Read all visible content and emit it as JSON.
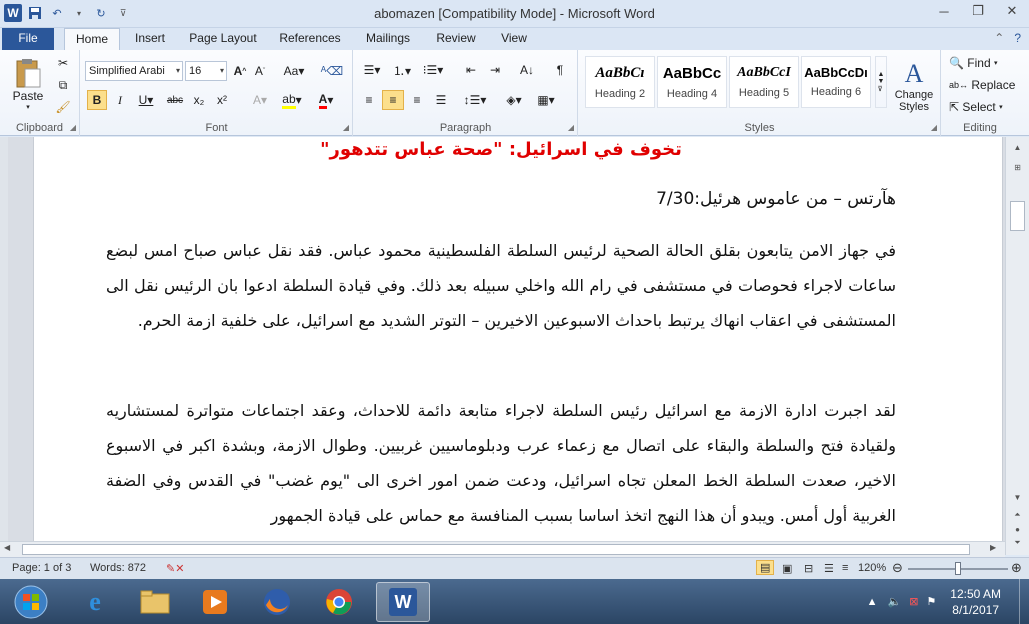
{
  "window": {
    "title": "abomazen [Compatibility Mode]  -  Microsoft Word"
  },
  "tabs": [
    {
      "label": "File"
    },
    {
      "label": "Home"
    },
    {
      "label": "Insert"
    },
    {
      "label": "Page Layout"
    },
    {
      "label": "References"
    },
    {
      "label": "Mailings"
    },
    {
      "label": "Review"
    },
    {
      "label": "View"
    }
  ],
  "ribbon": {
    "clipboard": {
      "paste_label": "Paste",
      "group_label": "Clipboard"
    },
    "font": {
      "font_name": "Simplified Arabi",
      "font_size": "16",
      "group_label": "Font"
    },
    "paragraph": {
      "group_label": "Paragraph"
    },
    "styles": {
      "group_label": "Styles",
      "items": [
        {
          "sample": "AaBbCı",
          "name": "Heading 2"
        },
        {
          "sample": "AaBbCc",
          "name": "Heading 4"
        },
        {
          "sample": "AaBbCcI",
          "name": "Heading 5"
        },
        {
          "sample": "AaBbCcDı",
          "name": "Heading 6"
        }
      ],
      "change_styles": "Change Styles"
    },
    "editing": {
      "find": "Find",
      "replace": "Replace",
      "select": "Select",
      "group_label": "Editing"
    }
  },
  "document": {
    "headline": "تخوف في اسرائيل: \"صحة عباس تتدهور\"",
    "byline": "هآرتس – من عاموس هرئيل:7/30",
    "paragraph1": "في جهاز الامن يتابعون بقلق الحالة الصحية لرئيس السلطة الفلسطينية محمود عباس. فقد نقل عباس صباح امس لبضع ساعات لاجراء فحوصات في مستشفى في رام الله واخلي سبيله بعد ذلك. وفي قيادة السلطة ادعوا بان الرئيس نقل الى المستشفى في اعقاب انهاك يرتبط باحداث الاسبوعين الاخيرين – التوتر الشديد مع اسرائيل، على خلفية ازمة الحرم.",
    "paragraph2": "لقد اجبرت ادارة الازمة مع اسرائيل رئيس السلطة لاجراء متابعة دائمة للاحداث، وعقد اجتماعات متواترة لمستشاريه ولقيادة فتح والسلطة والبقاء على اتصال مع زعماء عرب ودبلوماسيين غربيين. وطوال الازمة، وبشدة اكبر في الاسبوع الاخير، صعدت السلطة الخط المعلن تجاه اسرائيل، ودعت ضمن امور اخرى الى \"يوم غضب\" في القدس وفي الضفة الغربية أول أمس. ويبدو أن هذا النهج اتخذ اساسا بسبب المنافسة مع حماس على قيادة الجمهور"
  },
  "status": {
    "page": "Page: 1 of 3",
    "words": "Words: 872",
    "zoom": "120%"
  },
  "taskbar": {
    "time": "12:50 AM",
    "date": "8/1/2017"
  },
  "colors": {
    "accent": "#2b579a",
    "headline": "#e00000"
  }
}
